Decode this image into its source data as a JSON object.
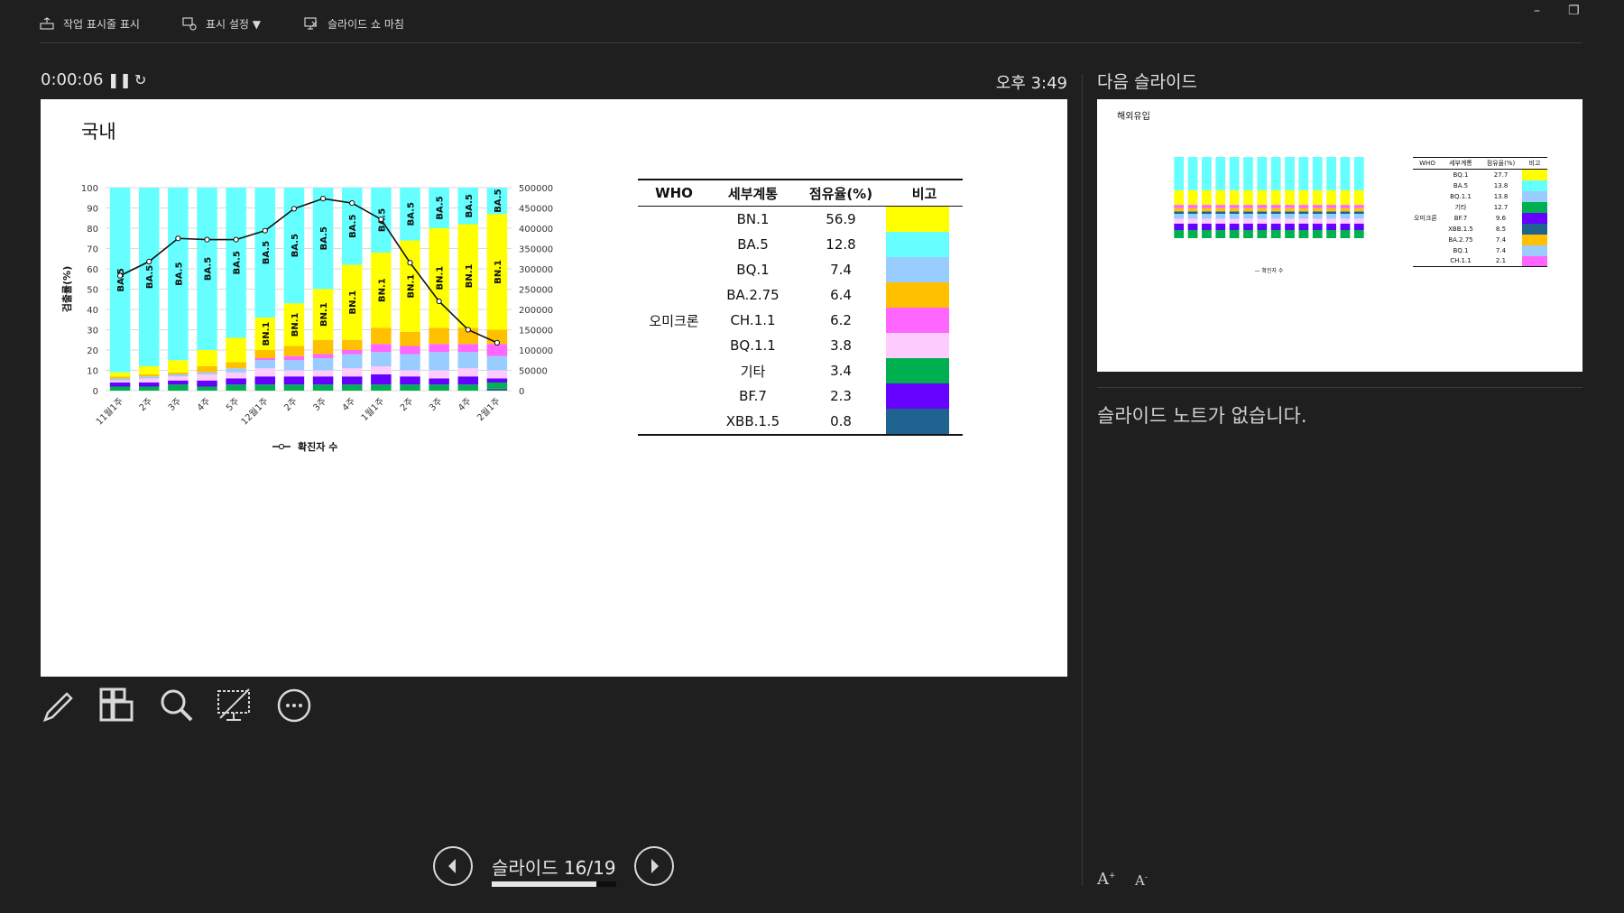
{
  "toolbar": {
    "show_taskbar": "작업 표시줄 표시",
    "display_settings": "표시 설정 ▼",
    "end_slideshow": "슬라이드 쇼 마침"
  },
  "presenter": {
    "elapsed": "0:00:06",
    "clock": "오후 3:49",
    "next_label": "다음 슬라이드",
    "notes": "슬라이드 노트가 없습니다.",
    "slide_counter": "슬라이드 16/19",
    "progress_fraction": 0.84,
    "tools": [
      "pen-tool-icon",
      "all-slides-icon",
      "zoom-icon",
      "black-screen-icon",
      "more-options-icon"
    ]
  },
  "slide": {
    "title": "국내",
    "table": {
      "headers": [
        "WHO",
        "세부계통",
        "점유율(%)",
        "비고"
      ],
      "group": "오미크론",
      "rows": [
        {
          "lineage": "BN.1",
          "share": "56.9",
          "color": "#ffff00"
        },
        {
          "lineage": "BA.5",
          "share": "12.8",
          "color": "#66ffff"
        },
        {
          "lineage": "BQ.1",
          "share": "7.4",
          "color": "#99ccff"
        },
        {
          "lineage": "BA.2.75",
          "share": "6.4",
          "color": "#ffc000"
        },
        {
          "lineage": "CH.1.1",
          "share": "6.2",
          "color": "#ff66ff"
        },
        {
          "lineage": "BQ.1.1",
          "share": "3.8",
          "color": "#ffccff"
        },
        {
          "lineage": "기타",
          "share": "3.4",
          "color": "#00b050"
        },
        {
          "lineage": "BF.7",
          "share": "2.3",
          "color": "#6600ff"
        },
        {
          "lineage": "XBB.1.5",
          "share": "0.8",
          "color": "#1f6391"
        }
      ]
    },
    "chart_data": {
      "type": "bar",
      "stacked": true,
      "categories": [
        "11월1주",
        "2주",
        "3주",
        "4주",
        "5주",
        "12월1주",
        "2주",
        "3주",
        "4주",
        "1월1주",
        "2주",
        "3주",
        "4주",
        "2월1주"
      ],
      "ylabel": "검출률(%)",
      "ylim": [
        0,
        100
      ],
      "yticks": [
        0,
        10,
        20,
        30,
        40,
        50,
        60,
        70,
        80,
        90,
        100
      ],
      "y2ticks": [
        "0",
        "50000",
        "100000",
        "150000",
        "200000",
        "250000",
        "300000",
        "350000",
        "400000",
        "450000",
        "500000"
      ],
      "y2lim": [
        0,
        500000
      ],
      "legend": "확진자 수",
      "legend_position": "bottom",
      "series": [
        {
          "key": "XBB.1.5",
          "color": "#1f6391",
          "values": [
            0,
            0,
            0,
            0,
            0,
            0,
            0,
            0,
            0,
            0,
            0,
            0,
            0,
            1
          ]
        },
        {
          "key": "기타",
          "color": "#00b050",
          "values": [
            2,
            2,
            3,
            2,
            3,
            3,
            3,
            3,
            3,
            3,
            3,
            3,
            3,
            3
          ]
        },
        {
          "key": "BF.7",
          "color": "#6600ff",
          "values": [
            2,
            2,
            2,
            3,
            3,
            4,
            4,
            4,
            4,
            5,
            4,
            3,
            4,
            2
          ]
        },
        {
          "key": "BQ.1.1",
          "color": "#ffccff",
          "values": [
            1,
            2,
            2,
            3,
            3,
            4,
            3,
            3,
            4,
            4,
            3,
            4,
            4,
            4
          ]
        },
        {
          "key": "BQ.1",
          "color": "#99ccff",
          "values": [
            1,
            1,
            1,
            1,
            2,
            4,
            5,
            6,
            7,
            7,
            8,
            9,
            8,
            7
          ]
        },
        {
          "key": "CH.1.1",
          "color": "#ff66ff",
          "values": [
            0,
            0,
            0,
            0,
            0,
            1,
            2,
            2,
            2,
            4,
            4,
            4,
            4,
            6
          ]
        },
        {
          "key": "BA.2.75",
          "color": "#ffc000",
          "values": [
            1,
            1,
            1,
            3,
            3,
            4,
            5,
            7,
            5,
            8,
            7,
            8,
            8,
            7
          ]
        },
        {
          "key": "BN.1",
          "color": "#ffff00",
          "values": [
            2,
            4,
            6,
            8,
            12,
            16,
            21,
            25,
            37,
            37,
            45,
            49,
            51,
            57
          ]
        },
        {
          "key": "BA.5",
          "color": "#66ffff",
          "values": [
            91,
            88,
            85,
            80,
            74,
            64,
            57,
            50,
            38,
            32,
            26,
            20,
            18,
            13
          ]
        }
      ],
      "bar_labels": [
        {
          "index": 0,
          "series": "BA.5",
          "text": "BA.5"
        },
        {
          "index": 1,
          "series": "BA.5",
          "text": "BA.5"
        },
        {
          "index": 2,
          "series": "BA.5",
          "text": "BA.5"
        },
        {
          "index": 3,
          "series": "BA.5",
          "text": "BA.5"
        },
        {
          "index": 4,
          "series": "BA.5",
          "text": "BA.5"
        },
        {
          "index": 5,
          "series": "BA.5",
          "text": "BA.5"
        },
        {
          "index": 5,
          "series": "BN.1",
          "text": "BN.1"
        },
        {
          "index": 6,
          "series": "BA.5",
          "text": "BA.5"
        },
        {
          "index": 6,
          "series": "BN.1",
          "text": "BN.1"
        },
        {
          "index": 7,
          "series": "BA.5",
          "text": "BA.5"
        },
        {
          "index": 7,
          "series": "BN.1",
          "text": "BN.1"
        },
        {
          "index": 8,
          "series": "BA.5",
          "text": "BA.5"
        },
        {
          "index": 8,
          "series": "BN.1",
          "text": "BN.1"
        },
        {
          "index": 9,
          "series": "BA.5",
          "text": "BA.5"
        },
        {
          "index": 9,
          "series": "BN.1",
          "text": "BN.1"
        },
        {
          "index": 10,
          "series": "BA.5",
          "text": "BA.5"
        },
        {
          "index": 10,
          "series": "BN.1",
          "text": "BN.1"
        },
        {
          "index": 11,
          "series": "BA.5",
          "text": "BA.5"
        },
        {
          "index": 11,
          "series": "BN.1",
          "text": "BN.1"
        },
        {
          "index": 12,
          "series": "BA.5",
          "text": "BA.5"
        },
        {
          "index": 12,
          "series": "BN.1",
          "text": "BN.1"
        },
        {
          "index": 13,
          "series": "BA.5",
          "text": "BA.5"
        },
        {
          "index": 13,
          "series": "BN.1",
          "text": "BN.1"
        }
      ],
      "line": {
        "name": "확진자 수",
        "values": [
          283000,
          318000,
          375000,
          372000,
          372000,
          394000,
          448000,
          473000,
          462000,
          422000,
          315000,
          220000,
          150000,
          118000
        ]
      }
    }
  },
  "next_slide": {
    "title": "해외유입",
    "table_headers": [
      "WHO",
      "세부계통",
      "점유율(%)",
      "비고"
    ],
    "group": "오미크론",
    "rows": [
      {
        "lineage": "BQ.1",
        "share": "27.7",
        "color": "#ffff00"
      },
      {
        "lineage": "BA.5",
        "share": "13.8",
        "color": "#66ffff"
      },
      {
        "lineage": "BQ.1.1",
        "share": "13.8",
        "color": "#99ccff"
      },
      {
        "lineage": "기타",
        "share": "12.7",
        "color": "#00b050"
      },
      {
        "lineage": "BF.7",
        "share": "9.6",
        "color": "#6600ff"
      },
      {
        "lineage": "XBB.1.5",
        "share": "8.5",
        "color": "#1f6391"
      },
      {
        "lineage": "BA.2.75",
        "share": "7.4",
        "color": "#ffc000"
      },
      {
        "lineage": "BQ.1",
        "share": "7.4",
        "color": "#99ccff"
      },
      {
        "lineage": "CH.1.1",
        "share": "2.1",
        "color": "#ff66ff"
      }
    ],
    "legend": "확진자 수"
  }
}
